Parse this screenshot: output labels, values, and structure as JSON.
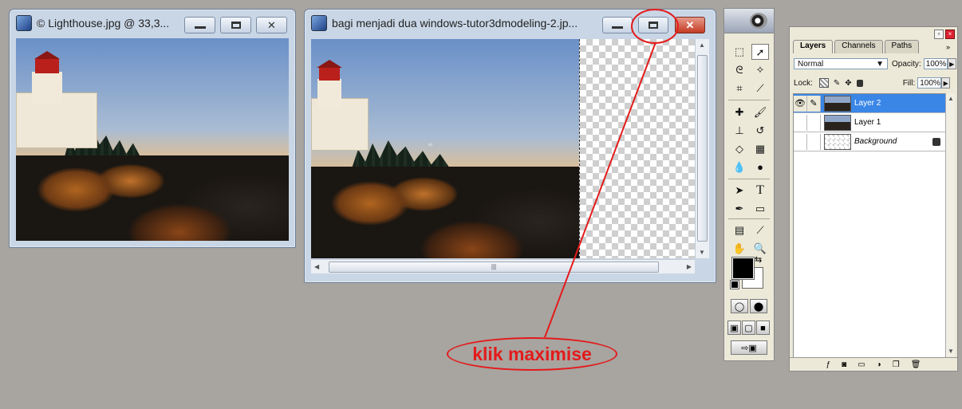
{
  "windows": {
    "lighthouse": {
      "title": "© Lighthouse.jpg @ 33,3...",
      "controls": {
        "minimize": "minimize",
        "maximize": "maximize",
        "close": "close"
      }
    },
    "bagi": {
      "title": "bagi menjadi dua windows-tutor3dmodeling-2.jp...",
      "controls": {
        "minimize": "minimize",
        "maximize": "maximize",
        "close": "close"
      },
      "scroll_grip": "|||"
    }
  },
  "annotation": {
    "text": "klik maximise",
    "color": "#e31b1b"
  },
  "toolbox": {
    "tools": [
      "rectangular-marquee",
      "move",
      "lasso",
      "magic-wand",
      "crop",
      "slice",
      "healing-brush",
      "brush",
      "clone-stamp",
      "history-brush",
      "eraser",
      "gradient",
      "blur",
      "dodge",
      "path-selection",
      "type",
      "pen",
      "rectangle-shape",
      "notes",
      "eyedropper",
      "hand",
      "zoom"
    ],
    "type_tool_glyph": "T",
    "foreground_color": "#000000",
    "background_color": "#ffffff"
  },
  "layers_panel": {
    "tabs": [
      "Layers",
      "Channels",
      "Paths"
    ],
    "active_tab": "Layers",
    "blend_mode": "Normal",
    "opacity_label": "Opacity:",
    "opacity": "100%",
    "lock_label": "Lock:",
    "fill_label": "Fill:",
    "fill": "100%",
    "layers": [
      {
        "name": "Layer 2",
        "selected": true,
        "visible": true
      },
      {
        "name": "Layer 1",
        "selected": false,
        "visible": false
      },
      {
        "name": "Background",
        "selected": false,
        "visible": false,
        "locked": true
      }
    ]
  }
}
